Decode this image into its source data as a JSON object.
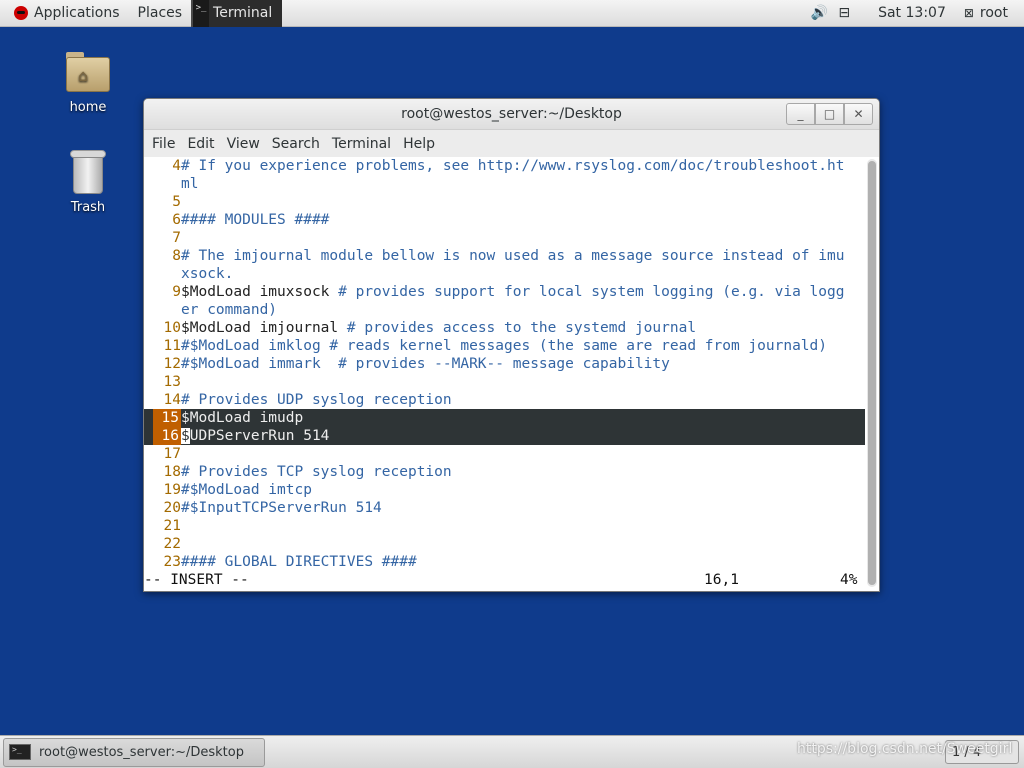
{
  "top_panel": {
    "applications": "Applications",
    "places": "Places",
    "active_app": "Terminal",
    "volume_icon": "volume-icon",
    "network_icon": "network-icon",
    "clock": "Sat 13:07",
    "user": "root"
  },
  "desktop": {
    "icons": [
      {
        "label": "home"
      },
      {
        "label": "Trash"
      }
    ]
  },
  "window": {
    "title": "root@westos_server:~/Desktop",
    "minimize": "_",
    "maximize": "□",
    "close": "✕",
    "menu": [
      "File",
      "Edit",
      "View",
      "Search",
      "Terminal",
      "Help"
    ]
  },
  "editor": {
    "lines": [
      {
        "n": "4",
        "text": "# If you experience problems, see http://www.rsyslog.com/doc/troubleshoot.ht",
        "type": "cmt"
      },
      {
        "n": "",
        "text": "ml",
        "type": "cmt"
      },
      {
        "n": "5",
        "text": "",
        "type": "cmt"
      },
      {
        "n": "6",
        "text": "#### MODULES ####",
        "type": "cmt"
      },
      {
        "n": "7",
        "text": "",
        "type": "cmt"
      },
      {
        "n": "8",
        "text": "# The imjournal module bellow is now used as a message source instead of imu",
        "type": "cmt"
      },
      {
        "n": "",
        "text": "xsock.",
        "type": "cmt"
      },
      {
        "n": "9",
        "text": "$ModLoad imuxsock # provides support for local system logging (e.g. via logg",
        "type": "mixed",
        "code": "$ModLoad imuxsock ",
        "comment": "# provides support for local system logging (e.g. via logg"
      },
      {
        "n": "",
        "text": "er command)",
        "type": "cmt"
      },
      {
        "n": "10",
        "text": "$ModLoad imjournal # provides access to the systemd journal",
        "type": "mixed",
        "code": "$ModLoad imjournal ",
        "comment": "# provides access to the systemd journal"
      },
      {
        "n": "11",
        "text": "#$ModLoad imklog # reads kernel messages (the same are read from journald)",
        "type": "cmt"
      },
      {
        "n": "12",
        "text": "#$ModLoad immark  # provides --MARK-- message capability",
        "type": "cmt"
      },
      {
        "n": "13",
        "text": "",
        "type": "cmt"
      },
      {
        "n": "14",
        "text": "# Provides UDP syslog reception",
        "type": "cmt"
      },
      {
        "n": "15",
        "text": "$ModLoad imudp",
        "type": "hl"
      },
      {
        "n": "16",
        "text": "$UDPServerRun 514",
        "type": "hl-cursor",
        "cursor": "$",
        "rest": "UDPServerRun 514"
      },
      {
        "n": "17",
        "text": "",
        "type": "cmt"
      },
      {
        "n": "18",
        "text": "# Provides TCP syslog reception",
        "type": "cmt"
      },
      {
        "n": "19",
        "text": "#$ModLoad imtcp",
        "type": "cmt"
      },
      {
        "n": "20",
        "text": "#$InputTCPServerRun 514",
        "type": "cmt"
      },
      {
        "n": "21",
        "text": "",
        "type": "cmt"
      },
      {
        "n": "22",
        "text": "",
        "type": "cmt"
      },
      {
        "n": "23",
        "text": "#### GLOBAL DIRECTIVES ####",
        "type": "cmt"
      }
    ],
    "mode": "-- INSERT --",
    "position": "16,1",
    "percent": "4%"
  },
  "taskbar": {
    "window_button": "root@westos_server:~/Desktop",
    "workspace": "1 / 4",
    "watermark": "https://blog.csdn.net/Sweetgirl"
  }
}
